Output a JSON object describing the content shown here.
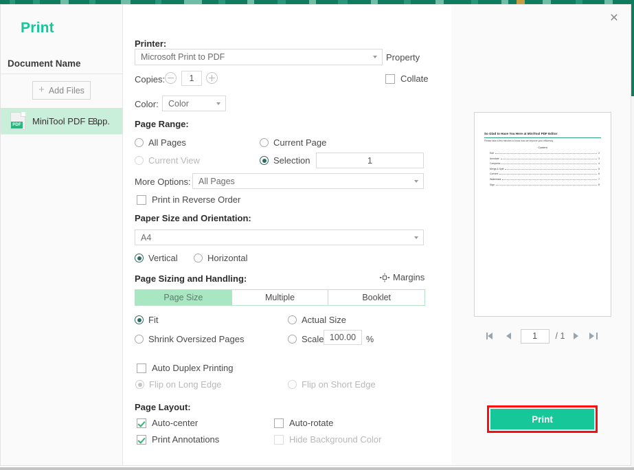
{
  "dialog": {
    "title": "Print",
    "close_icon": "close-icon"
  },
  "sidebar": {
    "document_name_label": "Document Name",
    "add_files_label": "Add Files",
    "add_files_icon": "plus-icon",
    "file": {
      "icon": "pdf-file-icon",
      "icon_tag": "PDF",
      "name": "MiniTool PDF E...",
      "pages": "8pp."
    }
  },
  "settings": {
    "printer_label": "Printer:",
    "printer_value": "Microsoft Print to PDF",
    "property_label": "Property",
    "copies_label": "Copies:",
    "copies_value": "1",
    "copies_minus_icon": "minus-circle-icon",
    "copies_plus_icon": "plus-circle-icon",
    "collate_label": "Collate",
    "collate_checked": false,
    "color_label": "Color:",
    "color_value": "Color",
    "page_range_label": "Page Range:",
    "all_pages_label": "All Pages",
    "current_page_label": "Current Page",
    "current_view_label": "Current View",
    "selection_label": "Selection",
    "selection_value": "1",
    "page_range_selected": "Selection",
    "more_options_label": "More Options:",
    "more_options_value": "All Pages",
    "reverse_order_label": "Print in Reverse Order",
    "reverse_order_checked": false,
    "paper_size_label": "Paper Size and Orientation:",
    "paper_size_value": "A4",
    "vertical_label": "Vertical",
    "horizontal_label": "Horizontal",
    "orientation_selected": "Vertical",
    "sizing_label": "Page Sizing and Handling:",
    "margins_label": "Margins",
    "margins_icon": "margins-icon",
    "tabs": [
      {
        "label": "Page Size",
        "active": true
      },
      {
        "label": "Multiple",
        "active": false
      },
      {
        "label": "Booklet",
        "active": false
      }
    ],
    "fit_label": "Fit",
    "actual_size_label": "Actual Size",
    "shrink_label": "Shrink Oversized Pages",
    "scale_label": "Scale",
    "scale_value": "100.00",
    "percent_sign": "%",
    "sizing_selected": "Fit",
    "duplex_label": "Auto Duplex Printing",
    "duplex_checked": false,
    "flip_long_label": "Flip on Long Edge",
    "flip_short_label": "Flip on Short Edge",
    "flip_selected": "Flip on Long Edge",
    "page_layout_label": "Page Layout:",
    "auto_center_label": "Auto-center",
    "auto_center_checked": true,
    "auto_rotate_label": "Auto-rotate",
    "auto_rotate_checked": false,
    "print_annotations_label": "Print Annotations",
    "print_annotations_checked": true,
    "hide_bg_label": "Hide Background Color",
    "hide_bg_checked": false
  },
  "preview": {
    "doc_title": "So Glad to Have You Here at MiniTool PDF Editor",
    "doc_subtitle": "Please take a few minutes to know how we improve your efficiency.",
    "contents_heading": "Content",
    "toc": [
      {
        "name": "Edit",
        "page": "2"
      },
      {
        "name": "Annotate",
        "page": "3"
      },
      {
        "name": "Compress",
        "page": "4"
      },
      {
        "name": "Merge & Split",
        "page": "5"
      },
      {
        "name": "Convert",
        "page": "6"
      },
      {
        "name": "Watermark",
        "page": "7"
      },
      {
        "name": "Sign",
        "page": "8"
      }
    ],
    "nav": {
      "first_icon": "first-page-icon",
      "prev_icon": "previous-page-icon",
      "page_value": "1",
      "page_total": "/ 1",
      "next_icon": "next-page-icon",
      "last_icon": "last-page-icon"
    },
    "print_button_label": "Print"
  },
  "colors": {
    "brand_green": "#16c79a",
    "app_toolbar_green": "#0f7b5f",
    "selection_green": "#c9eed9",
    "tab_active_green": "#a9e6c2",
    "annotation_red": "#fb0d0d"
  }
}
